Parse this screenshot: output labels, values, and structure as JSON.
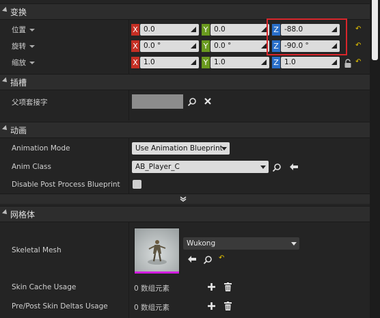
{
  "sections": {
    "transform": "变换",
    "socket": "插槽",
    "animation": "动画",
    "mesh": "网格体"
  },
  "transform": {
    "location_label": "位置",
    "rotation_label": "旋转",
    "scale_label": "缩放",
    "axis_x": "X",
    "axis_y": "Y",
    "axis_z": "Z",
    "location": {
      "x": "0.0",
      "y": "0.0",
      "z": "-88.0"
    },
    "rotation": {
      "x": "0.0 °",
      "y": "0.0 °",
      "z": "-90.0 °"
    },
    "scale": {
      "x": "1.0",
      "y": "1.0",
      "z": "1.0"
    }
  },
  "socket": {
    "parent_socket_label": "父项套接字",
    "parent_socket_value": ""
  },
  "animation": {
    "mode_label": "Animation Mode",
    "mode_value": "Use Animation Blueprint",
    "class_label": "Anim Class",
    "class_value": "AB_Player_C",
    "disable_post_label": "Disable Post Process Blueprint"
  },
  "mesh": {
    "skeletal_label": "Skeletal Mesh",
    "skeletal_value": "Wukong",
    "skin_cache_label": "Skin Cache Usage",
    "skin_cache_value": "0 数组元素",
    "skin_deltas_label": "Pre/Post Skin Deltas Usage",
    "skin_deltas_value": "0 数组元素"
  },
  "colors": {
    "axis_x": "#c52f24",
    "axis_y": "#6a9a1f",
    "axis_z": "#2a6fc9",
    "highlight_box": "#d9262b",
    "reset_arrow": "#e6c300",
    "thumb_underline": "#d21ce0"
  }
}
